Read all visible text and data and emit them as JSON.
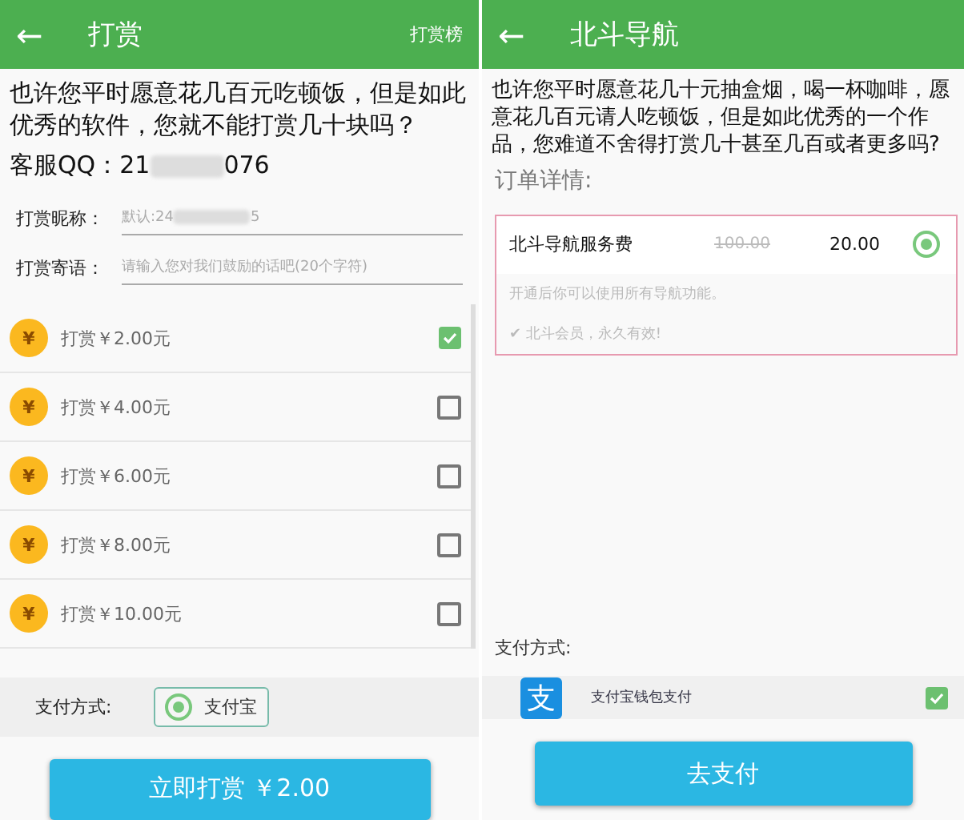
{
  "left": {
    "header": {
      "back": "←",
      "title": "打赏",
      "action": "打赏榜"
    },
    "intro": [
      "也许您平时愿意花几百元吃顿饭，但是如此优秀的软件，您就不能打赏几十块吗？"
    ],
    "qq": {
      "prefix": "客服QQ：21",
      "suffix": "076"
    },
    "fields": [
      {
        "label": "打赏昵称：",
        "value_prefix": "默认:24",
        "value_suffix": "5"
      },
      {
        "label": "打赏寄语：",
        "placeholder": "请输入您对我们鼓励的话吧(20个字符)"
      }
    ],
    "tiers": [
      {
        "coin": "¥",
        "label": "打赏￥2.00元",
        "checked": true
      },
      {
        "coin": "¥",
        "label": "打赏￥4.00元",
        "checked": false
      },
      {
        "coin": "¥",
        "label": "打赏￥6.00元",
        "checked": false
      },
      {
        "coin": "¥",
        "label": "打赏￥8.00元",
        "checked": false
      },
      {
        "coin": "¥",
        "label": "打赏￥10.00元",
        "checked": false
      }
    ],
    "payment": {
      "label": "支付方式:",
      "options": [
        {
          "label": "支付宝",
          "selected": true
        }
      ]
    },
    "submit": "立即打赏 ￥2.00"
  },
  "right": {
    "header": {
      "back": "←",
      "title": "北斗导航"
    },
    "intro": "也许您平时愿意花几十元抽盒烟，喝一杯咖啡，愿意花几百元请人吃顿饭，但是如此优秀的一个作品，您难道不舍得打赏几十甚至几百或者更多吗?",
    "order_heading": "订单详情:",
    "order": {
      "name": "北斗导航服务费",
      "original_price": "100.00",
      "price": "20.00",
      "selected": true,
      "note": "开通后你可以使用所有导航功能。",
      "perk": "✔ 北斗会员，永久有效!"
    },
    "payment_label": "支付方式:",
    "methods": [
      {
        "logo": "支",
        "label": "支付宝钱包支付",
        "checked": true
      }
    ],
    "submit": "去支付"
  }
}
